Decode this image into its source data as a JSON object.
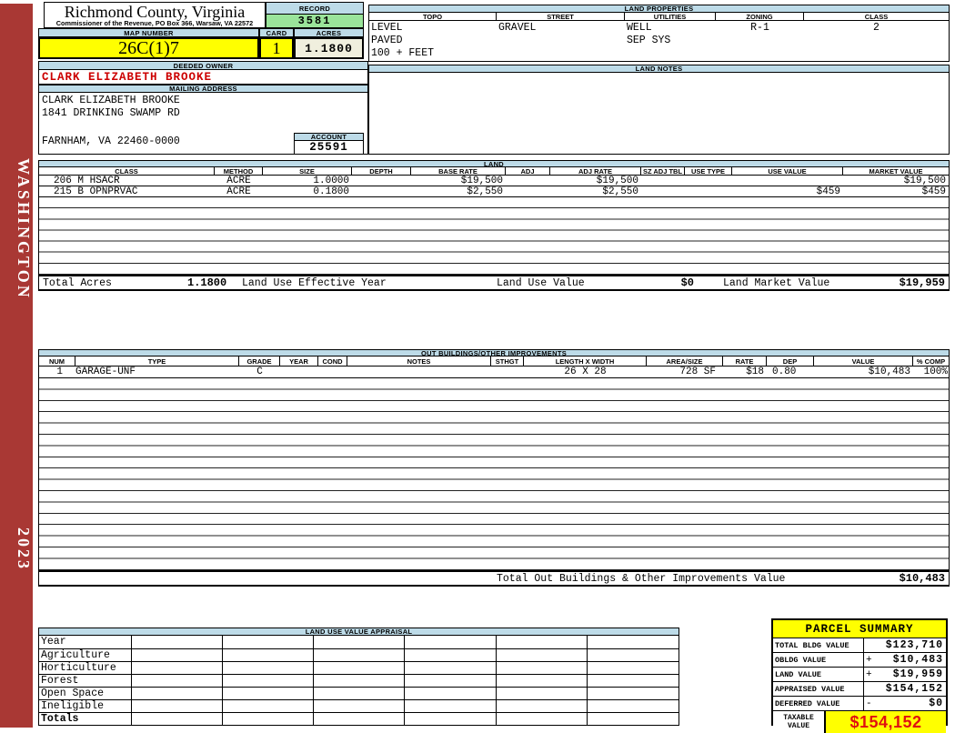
{
  "county_header": {
    "title": "Richmond County, Virginia",
    "subtitle": "Commissioner of the Revenue, PO Box 366, Warsaw, VA 22572"
  },
  "sidebar": {
    "district": "WASHINGTON",
    "year": "2023"
  },
  "record": {
    "label": "RECORD",
    "value": "3581"
  },
  "map": {
    "label": "MAP NUMBER",
    "value": "26C(1)7"
  },
  "card": {
    "label": "CARD",
    "value": "1"
  },
  "acres": {
    "label": "ACRES",
    "value": "1.1800"
  },
  "deeded_owner": {
    "label": "DEEDED OWNER",
    "value": "CLARK ELIZABETH BROOKE"
  },
  "mailing_address": {
    "label": "MAILING ADDRESS",
    "line1": "CLARK ELIZABETH BROOKE",
    "line2": "1841 DRINKING SWAMP RD",
    "line3": "FARNHAM, VA 22460-0000"
  },
  "account": {
    "label": "ACCOUNT",
    "value": "25591"
  },
  "land_properties": {
    "title": "LAND PROPERTIES",
    "columns": [
      "TOPO",
      "STREET",
      "UTILITIES",
      "ZONING",
      "CLASS"
    ],
    "topo": [
      "LEVEL",
      "PAVED",
      "100 + FEET"
    ],
    "street": [
      "GRAVEL"
    ],
    "utilities": [
      "WELL",
      "SEP SYS"
    ],
    "zoning": [
      "R-1"
    ],
    "class": [
      "2"
    ]
  },
  "land_notes": {
    "title": "LAND NOTES",
    "text": ""
  },
  "land_table": {
    "title": "LAND",
    "columns": [
      "CLASS",
      "METHOD",
      "SIZE",
      "DEPTH",
      "BASE RATE",
      "ADJ",
      "ADJ RATE",
      "SZ ADJ TBL",
      "USE TYPE",
      "USE VALUE",
      "MARKET VALUE"
    ],
    "rows": [
      {
        "class": "206 M HSACR",
        "method": "ACRE",
        "size": "1.0000",
        "depth": "",
        "base_rate": "$19,500",
        "adj": "",
        "adj_rate": "$19,500",
        "sz_adj_tbl": "",
        "use_type": "",
        "use_value": "",
        "market_value": "$19,500"
      },
      {
        "class": "215 B OPNPRVAC",
        "method": "ACRE",
        "size": "0.1800",
        "depth": "",
        "base_rate": "$2,550",
        "adj": "",
        "adj_rate": "$2,550",
        "sz_adj_tbl": "",
        "use_type": "",
        "use_value": "$459",
        "market_value": "$459"
      }
    ],
    "totals": {
      "total_acres_label": "Total Acres",
      "total_acres": "1.1800",
      "effective_year_label": "Land Use Effective Year",
      "effective_year": "",
      "use_value_label": "Land Use Value",
      "use_value": "$0",
      "market_value_label": "Land Market Value",
      "market_value": "$19,959"
    }
  },
  "outbuildings": {
    "title": "OUT BUILDINGS/OTHER IMPROVEMENTS",
    "columns": [
      "NUM",
      "TYPE",
      "GRADE",
      "YEAR",
      "COND",
      "NOTES",
      "STHGT",
      "LENGTH X WIDTH",
      "AREA/SIZE",
      "RATE",
      "DEP",
      "VALUE",
      "% COMP"
    ],
    "rows": [
      {
        "num": "1",
        "type": "GARAGE-UNF",
        "grade": "C",
        "year": "",
        "cond": "",
        "notes": "",
        "sthgt": "",
        "length_x_width": "26 X 28",
        "area_size": "728 SF",
        "rate": "$18",
        "dep": "0.80",
        "value": "$10,483",
        "pct_comp": "100%"
      }
    ],
    "total_label": "Total Out Buildings & Other Improvements Value",
    "total_value": "$10,483"
  },
  "land_use_appraisal": {
    "title": "LAND USE VALUE APPRAISAL",
    "row_labels": [
      "Year",
      "Agriculture",
      "Horticulture",
      "Forest",
      "Open Space",
      "Ineligible",
      "Totals"
    ]
  },
  "parcel_summary": {
    "title": "PARCEL SUMMARY",
    "rows": [
      {
        "label": "TOTAL BLDG VALUE",
        "op": "",
        "value": "$123,710"
      },
      {
        "label": "OBLDG VALUE",
        "op": "+",
        "value": "$10,483"
      },
      {
        "label": "LAND VALUE",
        "op": "+",
        "value": "$19,959"
      },
      {
        "label": "APPRAISED VALUE",
        "op": "",
        "value": "$154,152"
      },
      {
        "label": "DEFERRED VALUE",
        "op": "-",
        "value": "$0"
      }
    ],
    "taxable": {
      "label_line1": "TAXABLE",
      "label_line2": "VALUE",
      "value": "$154,152"
    }
  },
  "colors": {
    "header_blue": "#BDDBE8",
    "record_green": "#9AE49A",
    "accent_yellow": "#FFFF00",
    "acres_cream": "#F0EFDE",
    "owner_red": "#CC0000",
    "taxable_red": "#E01010",
    "sidebar_red": "#A93834"
  }
}
